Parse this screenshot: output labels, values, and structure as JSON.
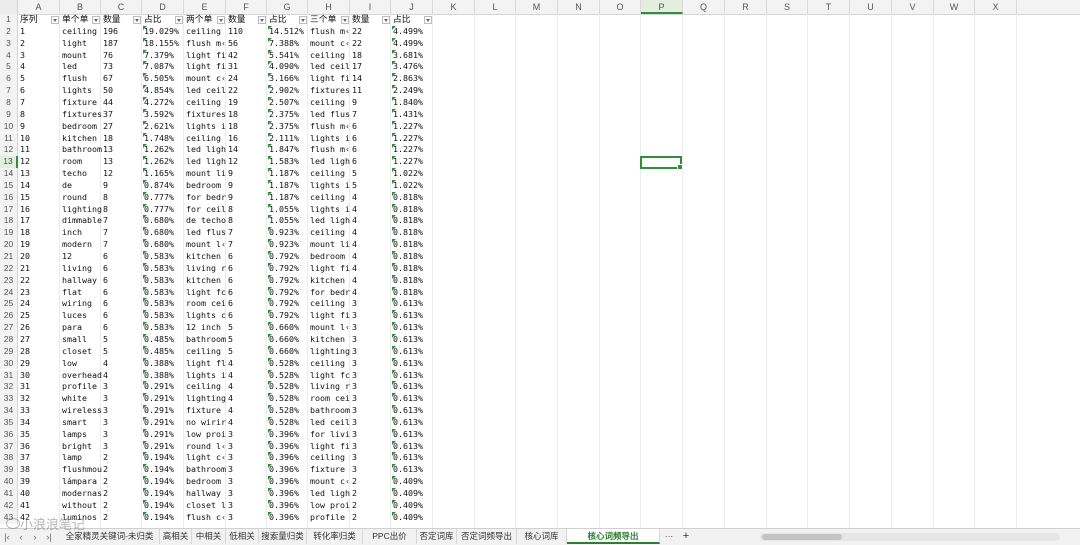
{
  "columns": [
    "A",
    "B",
    "C",
    "D",
    "E",
    "F",
    "G",
    "H",
    "I",
    "J",
    "K",
    "L",
    "M",
    "N",
    "O",
    "P",
    "Q",
    "R",
    "S",
    "T",
    "U",
    "V",
    "W",
    "X"
  ],
  "selected_column": "P",
  "selected_row": "13",
  "headers": [
    "序列",
    "单个单",
    "数量",
    "占比",
    "两个单",
    "数量",
    "占比",
    "三个单",
    "数量",
    "占比"
  ],
  "rows": [
    [
      "1",
      "1",
      "ceiling",
      "196",
      "19.029%",
      "ceiling",
      "110",
      "14.512%",
      "flush m‹",
      "22",
      "4.499%"
    ],
    [
      "2",
      "2",
      "light",
      "187",
      "18.155%",
      "flush m‹",
      "56",
      "7.388%",
      "mount c‹",
      "22",
      "4.499%"
    ],
    [
      "3",
      "3",
      "mount",
      "76",
      "7.379%",
      "light fi",
      "42",
      "5.541%",
      "ceiling",
      "18",
      "3.681%"
    ],
    [
      "4",
      "4",
      "led",
      "73",
      "7.087%",
      "light fi",
      "31",
      "4.090%",
      "led ceil",
      "17",
      "3.476%"
    ],
    [
      "5",
      "5",
      "flush",
      "67",
      "6.505%",
      "mount c‹",
      "24",
      "3.166%",
      "light fi",
      "14",
      "2.863%"
    ],
    [
      "6",
      "6",
      "lights",
      "50",
      "4.854%",
      "led ceil",
      "22",
      "2.902%",
      "fixtures",
      "11",
      "2.249%"
    ],
    [
      "7",
      "7",
      "fixture",
      "44",
      "4.272%",
      "ceiling",
      "19",
      "2.507%",
      "ceiling",
      "9",
      "1.840%"
    ],
    [
      "8",
      "8",
      "fixtures",
      "37",
      "3.592%",
      "fixtures",
      "18",
      "2.375%",
      "led flus",
      "7",
      "1.431%"
    ],
    [
      "9",
      "9",
      "bedroom",
      "27",
      "2.621%",
      "lights i",
      "18",
      "2.375%",
      "flush m‹",
      "6",
      "1.227%"
    ],
    [
      "10",
      "10",
      "kitchen",
      "18",
      "1.748%",
      "ceiling",
      "16",
      "2.111%",
      "lights i",
      "6",
      "1.227%"
    ],
    [
      "11",
      "11",
      "bathroom",
      "13",
      "1.262%",
      "led ligh",
      "14",
      "1.847%",
      "flush m‹",
      "6",
      "1.227%"
    ],
    [
      "12",
      "12",
      "room",
      "13",
      "1.262%",
      "led ligh",
      "12",
      "1.583%",
      "led ligh",
      "6",
      "1.227%"
    ],
    [
      "13",
      "13",
      "techo",
      "12",
      "1.165%",
      "mount li",
      "9",
      "1.187%",
      "ceiling",
      "5",
      "1.022%"
    ],
    [
      "14",
      "14",
      "de",
      "9",
      "0.874%",
      "bedroom",
      "9",
      "1.187%",
      "lights i",
      "5",
      "1.022%"
    ],
    [
      "15",
      "15",
      "round",
      "8",
      "0.777%",
      "for bedr",
      "9",
      "1.187%",
      "ceiling",
      "4",
      "0.818%"
    ],
    [
      "16",
      "16",
      "lighting",
      "8",
      "0.777%",
      "for ceil",
      "8",
      "1.055%",
      "lights i",
      "4",
      "0.818%"
    ],
    [
      "17",
      "17",
      "dimmable",
      "7",
      "0.680%",
      "de techo",
      "8",
      "1.055%",
      "led ligh",
      "4",
      "0.818%"
    ],
    [
      "18",
      "18",
      "inch",
      "7",
      "0.680%",
      "led flus",
      "7",
      "0.923%",
      "ceiling",
      "4",
      "0.818%"
    ],
    [
      "19",
      "19",
      "modern",
      "7",
      "0.680%",
      "mount l‹",
      "7",
      "0.923%",
      "mount li",
      "4",
      "0.818%"
    ],
    [
      "20",
      "20",
      "12",
      "6",
      "0.583%",
      "kitchen",
      "6",
      "0.792%",
      "bedroom",
      "4",
      "0.818%"
    ],
    [
      "21",
      "21",
      "living",
      "6",
      "0.583%",
      "living r",
      "6",
      "0.792%",
      "light fi",
      "4",
      "0.818%"
    ],
    [
      "22",
      "22",
      "hallway",
      "6",
      "0.583%",
      "kitchen",
      "6",
      "0.792%",
      "kitchen",
      "4",
      "0.818%"
    ],
    [
      "23",
      "23",
      "flat",
      "6",
      "0.583%",
      "light fc",
      "6",
      "0.792%",
      "for bedr",
      "4",
      "0.818%"
    ],
    [
      "24",
      "24",
      "wiring",
      "6",
      "0.583%",
      "room cei",
      "6",
      "0.792%",
      "ceiling",
      "3",
      "0.613%"
    ],
    [
      "25",
      "25",
      "luces",
      "6",
      "0.583%",
      "lights c",
      "6",
      "0.792%",
      "light fi",
      "3",
      "0.613%"
    ],
    [
      "26",
      "26",
      "para",
      "6",
      "0.583%",
      "12 inch",
      "5",
      "0.660%",
      "mount l‹",
      "3",
      "0.613%"
    ],
    [
      "27",
      "27",
      "small",
      "5",
      "0.485%",
      "bathroom",
      "5",
      "0.660%",
      "kitchen",
      "3",
      "0.613%"
    ],
    [
      "28",
      "28",
      "closet",
      "5",
      "0.485%",
      "ceiling",
      "5",
      "0.660%",
      "lighting",
      "3",
      "0.613%"
    ],
    [
      "29",
      "29",
      "low",
      "4",
      "0.388%",
      "light fl",
      "4",
      "0.528%",
      "ceiling",
      "3",
      "0.613%"
    ],
    [
      "30",
      "30",
      "overhead",
      "4",
      "0.388%",
      "lights i",
      "4",
      "0.528%",
      "light fc",
      "3",
      "0.613%"
    ],
    [
      "31",
      "31",
      "profile",
      "3",
      "0.291%",
      "ceiling",
      "4",
      "0.528%",
      "living r",
      "3",
      "0.613%"
    ],
    [
      "32",
      "32",
      "white",
      "3",
      "0.291%",
      "lighting",
      "4",
      "0.528%",
      "room cei",
      "3",
      "0.613%"
    ],
    [
      "33",
      "33",
      "wireless",
      "3",
      "0.291%",
      "fixture",
      "4",
      "0.528%",
      "bathroom",
      "3",
      "0.613%"
    ],
    [
      "34",
      "34",
      "smart",
      "3",
      "0.291%",
      "no wirir",
      "4",
      "0.528%",
      "led ceil",
      "3",
      "0.613%"
    ],
    [
      "35",
      "35",
      "lamps",
      "3",
      "0.291%",
      "low proi",
      "3",
      "0.396%",
      "for livi",
      "3",
      "0.613%"
    ],
    [
      "36",
      "36",
      "bright",
      "3",
      "0.291%",
      "round l‹",
      "3",
      "0.396%",
      "light fi",
      "3",
      "0.613%"
    ],
    [
      "37",
      "37",
      "lamp",
      "2",
      "0.194%",
      "light c‹",
      "3",
      "0.396%",
      "ceiling",
      "3",
      "0.613%"
    ],
    [
      "38",
      "38",
      "flushmou",
      "2",
      "0.194%",
      "bathroom",
      "3",
      "0.396%",
      "fixture",
      "3",
      "0.613%"
    ],
    [
      "39",
      "39",
      "lámpara",
      "2",
      "0.194%",
      "bedroom",
      "3",
      "0.396%",
      "mount c‹",
      "2",
      "0.409%"
    ],
    [
      "40",
      "40",
      "modernas",
      "2",
      "0.194%",
      "hallway",
      "3",
      "0.396%",
      "led ligh",
      "2",
      "0.409%"
    ],
    [
      "41",
      "41",
      "without",
      "2",
      "0.194%",
      "closet l",
      "3",
      "0.396%",
      "low proi",
      "2",
      "0.409%"
    ],
    [
      "42",
      "42",
      "luminos",
      "2",
      "0.194%",
      "flush c‹",
      "3",
      "0.396%",
      "profile",
      "2",
      "0.409%"
    ]
  ],
  "tabs": [
    {
      "label": "全家精灵关键词-未归类",
      "active": false
    },
    {
      "label": "高相关",
      "active": false
    },
    {
      "label": "中相关",
      "active": false
    },
    {
      "label": "低相关",
      "active": false
    },
    {
      "label": "搜索量归类",
      "active": false
    },
    {
      "label": "转化率归类",
      "active": false
    },
    {
      "label": "PPC出价",
      "active": false
    },
    {
      "label": "否定词库",
      "active": false
    },
    {
      "label": "否定词频导出",
      "active": false
    },
    {
      "label": "核心词库",
      "active": false
    },
    {
      "label": "核心词频导出",
      "active": true
    }
  ],
  "tab_more": "···",
  "tab_add": "+",
  "watermark": "小浪浪笔记",
  "nav_icons": [
    "first-sheet-icon",
    "prev-sheet-icon",
    "next-sheet-icon",
    "last-sheet-icon"
  ],
  "accent_color": "#2f8f3a"
}
